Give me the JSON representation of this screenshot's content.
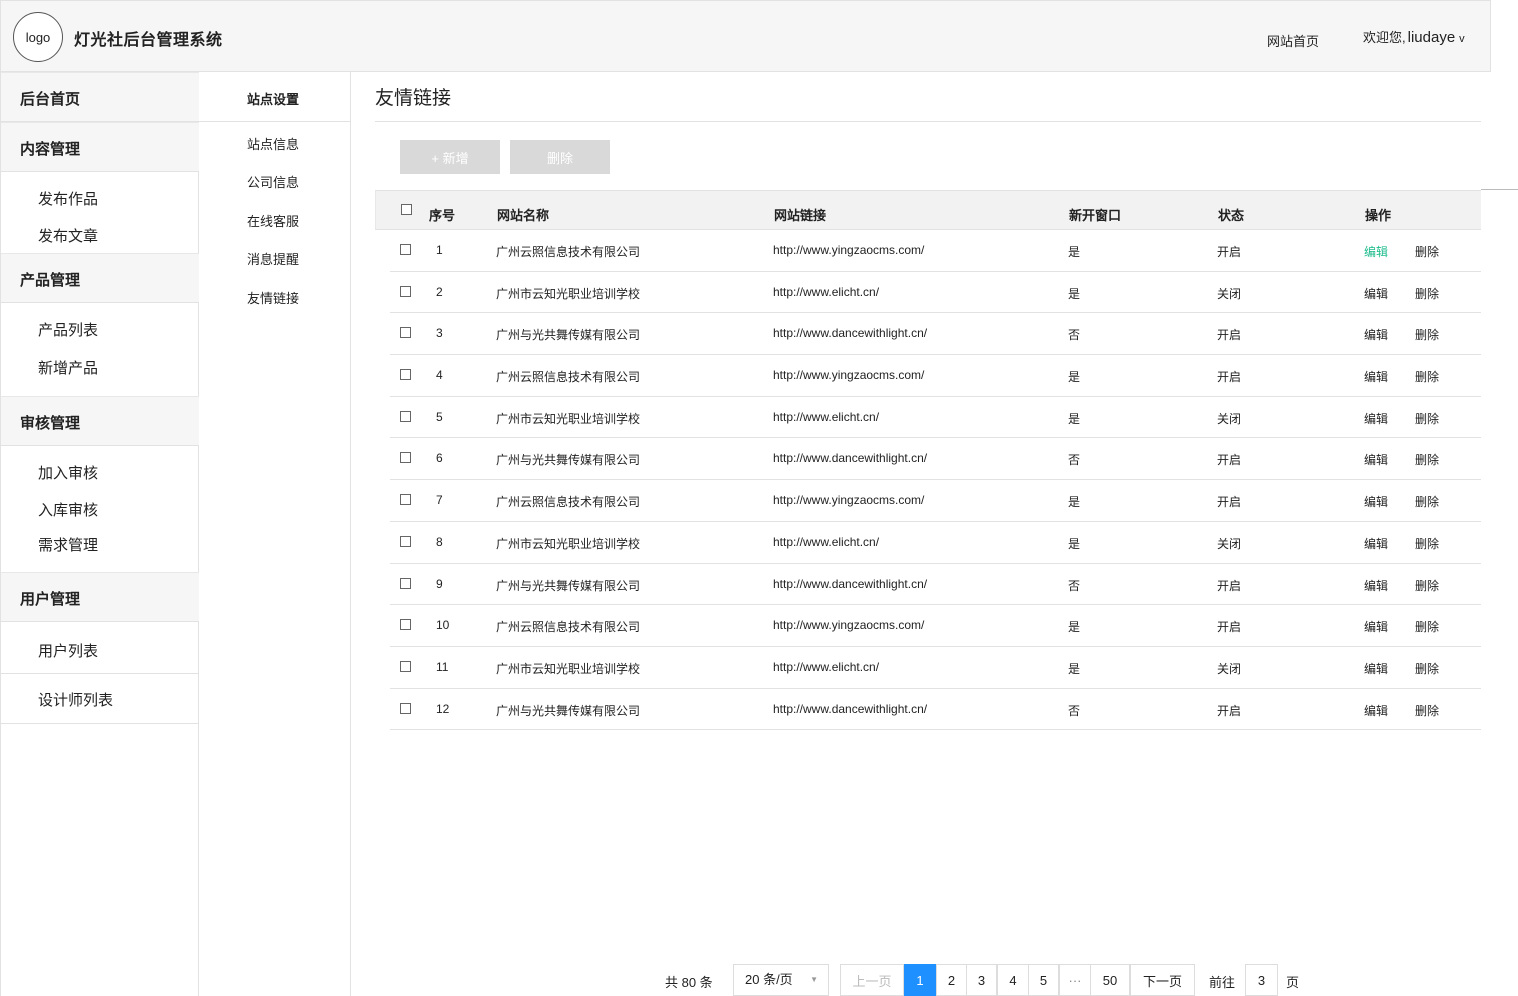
{
  "header": {
    "logo": "logo",
    "title": "灯光社后台管理系统",
    "home_link": "网站首页",
    "welcome_prefix": "欢迎您,",
    "username": "liudaye",
    "caret": "v"
  },
  "sidebar": {
    "home": "后台首页",
    "content": "内容管理",
    "content_items": [
      "发布作品",
      "发布文章"
    ],
    "product": "产品管理",
    "product_items": [
      "产品列表",
      "新增产品"
    ],
    "review": "审核管理",
    "review_items": [
      "加入审核",
      "入库审核",
      "需求管理"
    ],
    "user": "用户管理",
    "user_items": [
      "用户列表",
      "设计师列表"
    ]
  },
  "subnav": {
    "head": "站点设置",
    "items": [
      "站点信息",
      "公司信息",
      "在线客服",
      "消息提醒",
      "友情链接"
    ]
  },
  "main": {
    "title": "友情链接",
    "add_label": "+ 新增",
    "delete_label": "删除"
  },
  "table": {
    "headers": [
      "序号",
      "网站名称",
      "网站链接",
      "新开窗口",
      "状态",
      "操作"
    ],
    "edit_label": "编辑",
    "delete_label": "删除",
    "rows": [
      [
        "1",
        "广州云照信息技术有限公司",
        "http://www.yingzaocms.com/",
        "是",
        "开启"
      ],
      [
        "2",
        "广州市云知光职业培训学校",
        "http://www.elicht.cn/",
        "是",
        "关闭"
      ],
      [
        "3",
        "广州与光共舞传媒有限公司",
        "http://www.dancewithlight.cn/",
        "否",
        "开启"
      ],
      [
        "4",
        "广州云照信息技术有限公司",
        "http://www.yingzaocms.com/",
        "是",
        "开启"
      ],
      [
        "5",
        "广州市云知光职业培训学校",
        "http://www.elicht.cn/",
        "是",
        "关闭"
      ],
      [
        "6",
        "广州与光共舞传媒有限公司",
        "http://www.dancewithlight.cn/",
        "否",
        "开启"
      ],
      [
        "7",
        "广州云照信息技术有限公司",
        "http://www.yingzaocms.com/",
        "是",
        "开启"
      ],
      [
        "8",
        "广州市云知光职业培训学校",
        "http://www.elicht.cn/",
        "是",
        "关闭"
      ],
      [
        "9",
        "广州与光共舞传媒有限公司",
        "http://www.dancewithlight.cn/",
        "否",
        "开启"
      ],
      [
        "10",
        "广州云照信息技术有限公司",
        "http://www.yingzaocms.com/",
        "是",
        "开启"
      ],
      [
        "11",
        "广州市云知光职业培训学校",
        "http://www.elicht.cn/",
        "是",
        "关闭"
      ],
      [
        "12",
        "广州与光共舞传媒有限公司",
        "http://www.dancewithlight.cn/",
        "否",
        "开启"
      ]
    ]
  },
  "pagination": {
    "total": "共 80 条",
    "page_size": "20 条/页",
    "prev": "上一页",
    "pages": [
      "1",
      "2",
      "3",
      "4",
      "5"
    ],
    "ellipsis": "···",
    "last": "50",
    "next": "下一页",
    "goto_label": "前往",
    "goto_value": "3",
    "goto_unit": "页"
  },
  "colors": {
    "accent": "#1dbb8c",
    "current_page": "#1e90ff",
    "disabled_button": "#d9d9d9"
  }
}
